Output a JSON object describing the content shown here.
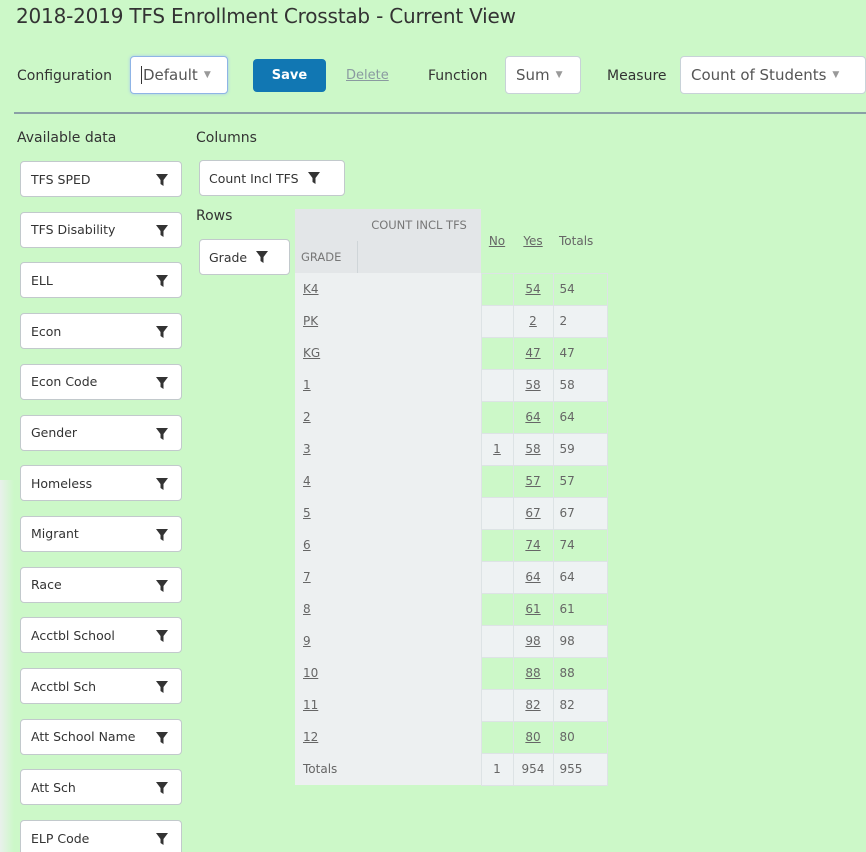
{
  "page": {
    "title": "2018-2019 TFS Enrollment Crosstab - Current View"
  },
  "toolbar": {
    "configuration_label": "Configuration",
    "configuration_value": "Default",
    "save_label": "Save",
    "delete_label": "Delete",
    "function_label": "Function",
    "function_value": "Sum",
    "measure_label": "Measure",
    "measure_value": "Count of Students"
  },
  "sections": {
    "available": "Available data",
    "columns": "Columns",
    "rows": "Rows"
  },
  "available_fields": [
    "TFS SPED",
    "TFS Disability",
    "ELL",
    "Econ",
    "Econ Code",
    "Gender",
    "Homeless",
    "Migrant",
    "Race",
    "Acctbl School",
    "Acctbl Sch",
    "Att School Name",
    "Att Sch",
    "ELP Code"
  ],
  "column_field": "Count Incl TFS",
  "row_field": "Grade",
  "crosstab": {
    "col_header": "COUNT INCL TFS",
    "row_header": "GRADE",
    "columns": [
      "No",
      "Yes",
      "Totals"
    ],
    "rows": [
      {
        "grade": "K4",
        "no": "",
        "yes": "54",
        "total": "54"
      },
      {
        "grade": "PK",
        "no": "",
        "yes": "2",
        "total": "2"
      },
      {
        "grade": "KG",
        "no": "",
        "yes": "47",
        "total": "47"
      },
      {
        "grade": "1",
        "no": "",
        "yes": "58",
        "total": "58"
      },
      {
        "grade": "2",
        "no": "",
        "yes": "64",
        "total": "64"
      },
      {
        "grade": "3",
        "no": "1",
        "yes": "58",
        "total": "59"
      },
      {
        "grade": "4",
        "no": "",
        "yes": "57",
        "total": "57"
      },
      {
        "grade": "5",
        "no": "",
        "yes": "67",
        "total": "67"
      },
      {
        "grade": "6",
        "no": "",
        "yes": "74",
        "total": "74"
      },
      {
        "grade": "7",
        "no": "",
        "yes": "64",
        "total": "64"
      },
      {
        "grade": "8",
        "no": "",
        "yes": "61",
        "total": "61"
      },
      {
        "grade": "9",
        "no": "",
        "yes": "98",
        "total": "98"
      },
      {
        "grade": "10",
        "no": "",
        "yes": "88",
        "total": "88"
      },
      {
        "grade": "11",
        "no": "",
        "yes": "82",
        "total": "82"
      },
      {
        "grade": "12",
        "no": "",
        "yes": "80",
        "total": "80"
      }
    ],
    "totals": {
      "label": "Totals",
      "no": "1",
      "yes": "954",
      "total": "955"
    }
  }
}
